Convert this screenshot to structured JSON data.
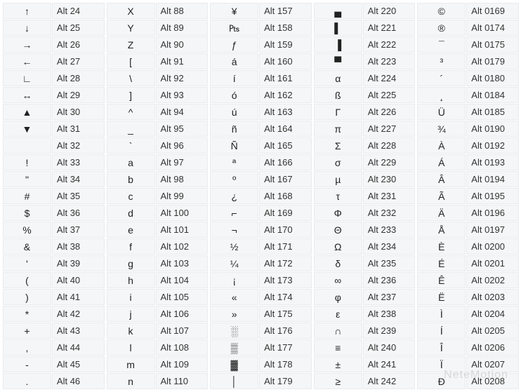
{
  "watermark": "NeteMotion",
  "columns": [
    [
      {
        "sym": "↑",
        "code": "Alt 24"
      },
      {
        "sym": "↓",
        "code": "Alt 25"
      },
      {
        "sym": "→",
        "code": "Alt 26"
      },
      {
        "sym": "←",
        "code": "Alt 27"
      },
      {
        "sym": "∟",
        "code": "Alt 28"
      },
      {
        "sym": "↔",
        "code": "Alt 29"
      },
      {
        "sym": "▲",
        "code": "Alt 30"
      },
      {
        "sym": "▼",
        "code": "Alt 31"
      },
      {
        "sym": "",
        "code": "Alt 32"
      },
      {
        "sym": "!",
        "code": "Alt 33"
      },
      {
        "sym": "\"",
        "code": "Alt 34"
      },
      {
        "sym": "#",
        "code": "Alt 35"
      },
      {
        "sym": "$",
        "code": "Alt 36"
      },
      {
        "sym": "%",
        "code": "Alt 37"
      },
      {
        "sym": "&",
        "code": "Alt 38"
      },
      {
        "sym": "'",
        "code": "Alt 39"
      },
      {
        "sym": "(",
        "code": "Alt 40"
      },
      {
        "sym": ")",
        "code": "Alt 41"
      },
      {
        "sym": "*",
        "code": "Alt 42"
      },
      {
        "sym": "+",
        "code": "Alt 43"
      },
      {
        "sym": ",",
        "code": "Alt 44"
      },
      {
        "sym": "-",
        "code": "Alt 45"
      },
      {
        "sym": ".",
        "code": "Alt 46"
      }
    ],
    [
      {
        "sym": "X",
        "code": "Alt 88"
      },
      {
        "sym": "Y",
        "code": "Alt 89"
      },
      {
        "sym": "Z",
        "code": "Alt 90"
      },
      {
        "sym": "[",
        "code": "Alt 91"
      },
      {
        "sym": "\\",
        "code": "Alt 92"
      },
      {
        "sym": "]",
        "code": "Alt 93"
      },
      {
        "sym": "^",
        "code": "Alt 94"
      },
      {
        "sym": "_",
        "code": "Alt 95"
      },
      {
        "sym": "`",
        "code": "Alt 96"
      },
      {
        "sym": "a",
        "code": "Alt 97"
      },
      {
        "sym": "b",
        "code": "Alt 98"
      },
      {
        "sym": "c",
        "code": "Alt 99"
      },
      {
        "sym": "d",
        "code": "Alt 100"
      },
      {
        "sym": "e",
        "code": "Alt 101"
      },
      {
        "sym": "f",
        "code": "Alt 102"
      },
      {
        "sym": "g",
        "code": "Alt 103"
      },
      {
        "sym": "h",
        "code": "Alt 104"
      },
      {
        "sym": "i",
        "code": "Alt 105"
      },
      {
        "sym": "j",
        "code": "Alt 106"
      },
      {
        "sym": "k",
        "code": "Alt 107"
      },
      {
        "sym": "l",
        "code": "Alt 108"
      },
      {
        "sym": "m",
        "code": "Alt 109"
      },
      {
        "sym": "n",
        "code": "Alt 110"
      }
    ],
    [
      {
        "sym": "¥",
        "code": "Alt 157"
      },
      {
        "sym": "₧",
        "code": "Alt 158"
      },
      {
        "sym": "ƒ",
        "code": "Alt 159"
      },
      {
        "sym": "á",
        "code": "Alt 160"
      },
      {
        "sym": "í",
        "code": "Alt 161"
      },
      {
        "sym": "ó",
        "code": "Alt 162"
      },
      {
        "sym": "ú",
        "code": "Alt 163"
      },
      {
        "sym": "ñ",
        "code": "Alt 164"
      },
      {
        "sym": "Ñ",
        "code": "Alt 165"
      },
      {
        "sym": "ª",
        "code": "Alt 166"
      },
      {
        "sym": "º",
        "code": "Alt 167"
      },
      {
        "sym": "¿",
        "code": "Alt 168"
      },
      {
        "sym": "⌐",
        "code": "Alt 169"
      },
      {
        "sym": "¬",
        "code": "Alt 170"
      },
      {
        "sym": "½",
        "code": "Alt 171"
      },
      {
        "sym": "¼",
        "code": "Alt 172"
      },
      {
        "sym": "¡",
        "code": "Alt 173"
      },
      {
        "sym": "«",
        "code": "Alt 174"
      },
      {
        "sym": "»",
        "code": "Alt 175"
      },
      {
        "sym": "░",
        "code": "Alt 176"
      },
      {
        "sym": "▒",
        "code": "Alt 177"
      },
      {
        "sym": "▓",
        "code": "Alt 178"
      },
      {
        "sym": "│",
        "code": "Alt 179"
      }
    ],
    [
      {
        "sym": "▄",
        "code": "Alt 220"
      },
      {
        "sym": "▌",
        "code": "Alt 221"
      },
      {
        "sym": "▐",
        "code": "Alt 222"
      },
      {
        "sym": "▀",
        "code": "Alt 223"
      },
      {
        "sym": "α",
        "code": "Alt 224"
      },
      {
        "sym": "ß",
        "code": "Alt 225"
      },
      {
        "sym": "Γ",
        "code": "Alt 226"
      },
      {
        "sym": "π",
        "code": "Alt 227"
      },
      {
        "sym": "Σ",
        "code": "Alt 228"
      },
      {
        "sym": "σ",
        "code": "Alt 229"
      },
      {
        "sym": "µ",
        "code": "Alt 230"
      },
      {
        "sym": "τ",
        "code": "Alt 231"
      },
      {
        "sym": "Φ",
        "code": "Alt 232"
      },
      {
        "sym": "Θ",
        "code": "Alt 233"
      },
      {
        "sym": "Ω",
        "code": "Alt 234"
      },
      {
        "sym": "δ",
        "code": "Alt 235"
      },
      {
        "sym": "∞",
        "code": "Alt 236"
      },
      {
        "sym": "φ",
        "code": "Alt 237"
      },
      {
        "sym": "ε",
        "code": "Alt 238"
      },
      {
        "sym": "∩",
        "code": "Alt 239"
      },
      {
        "sym": "≡",
        "code": "Alt 240"
      },
      {
        "sym": "±",
        "code": "Alt 241"
      },
      {
        "sym": "≥",
        "code": "Alt 242"
      }
    ],
    [
      {
        "sym": "©",
        "code": "Alt 0169"
      },
      {
        "sym": "®",
        "code": "Alt 0174"
      },
      {
        "sym": "¯",
        "code": "Alt 0175"
      },
      {
        "sym": "³",
        "code": "Alt 0179"
      },
      {
        "sym": "´",
        "code": "Alt 0180"
      },
      {
        "sym": "¸",
        "code": "Alt 0184"
      },
      {
        "sym": "Ü",
        "code": "Alt 0185"
      },
      {
        "sym": "¾",
        "code": "Alt 0190"
      },
      {
        "sym": "À",
        "code": "Alt 0192"
      },
      {
        "sym": "Á",
        "code": "Alt 0193"
      },
      {
        "sym": "Â",
        "code": "Alt 0194"
      },
      {
        "sym": "Ã",
        "code": "Alt 0195"
      },
      {
        "sym": "Ä",
        "code": "Alt 0196"
      },
      {
        "sym": "Å",
        "code": "Alt 0197"
      },
      {
        "sym": "È",
        "code": "Alt 0200"
      },
      {
        "sym": "É",
        "code": "Alt 0201"
      },
      {
        "sym": "Ê",
        "code": "Alt 0202"
      },
      {
        "sym": "Ë",
        "code": "Alt 0203"
      },
      {
        "sym": "Ì",
        "code": "Alt 0204"
      },
      {
        "sym": "Í",
        "code": "Alt 0205"
      },
      {
        "sym": "Î",
        "code": "Alt 0206"
      },
      {
        "sym": "Ï",
        "code": "Alt 0207"
      },
      {
        "sym": "Ð",
        "code": "Alt 0208"
      }
    ]
  ]
}
